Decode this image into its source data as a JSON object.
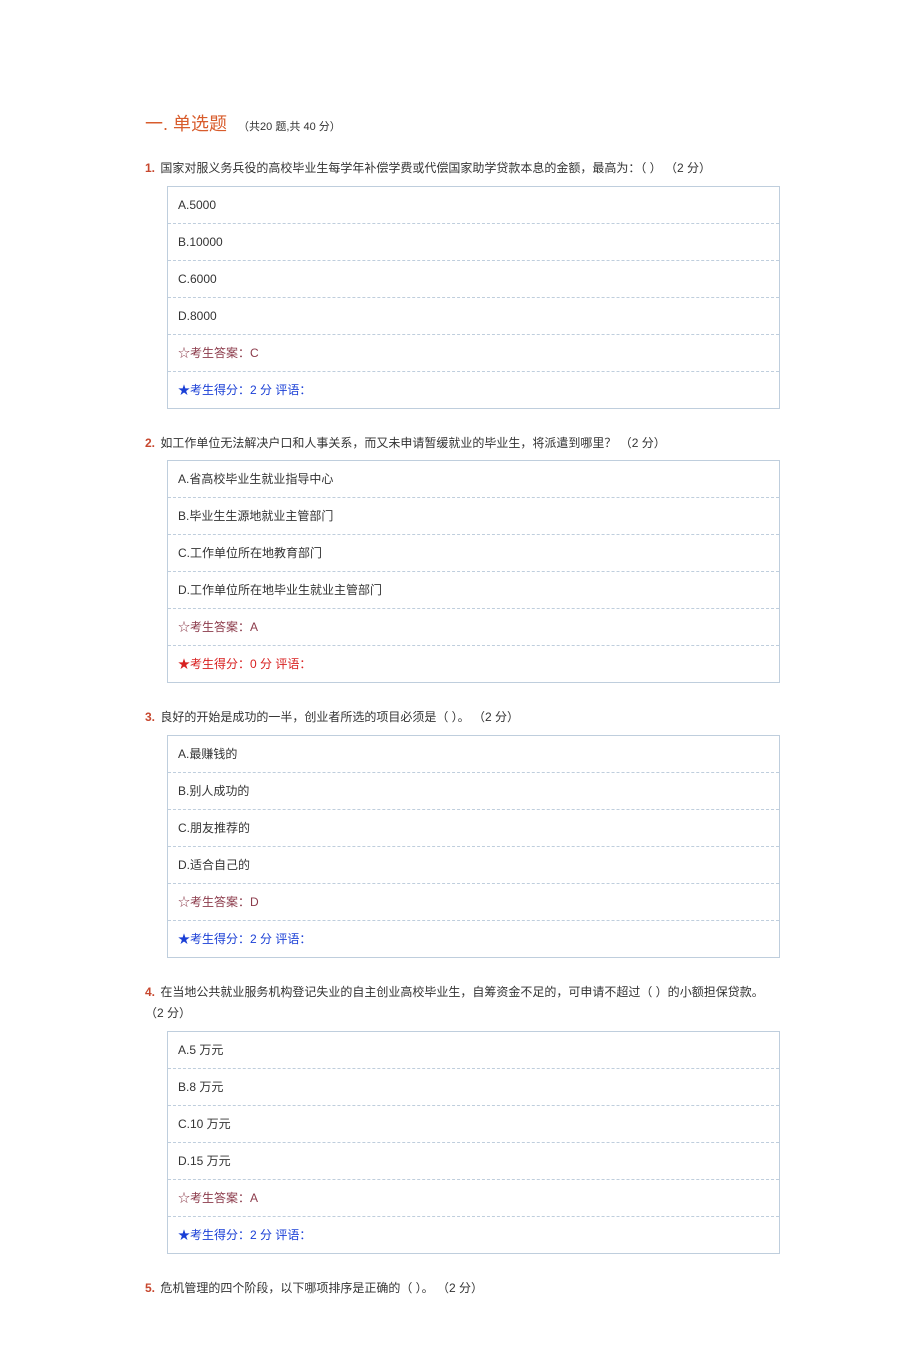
{
  "section": {
    "number": "一",
    "title": "单选题",
    "summary_prefix": "（共",
    "count": "20",
    "count_unit": "题,共",
    "total_points": "40",
    "points_unit": "分）"
  },
  "questions": [
    {
      "num": "1.",
      "stem": "国家对服义务兵役的高校毕业生每学年补偿学费或代偿国家助学贷款本息的金额，最高为：（   ）",
      "points": "（2 分）",
      "options": [
        "A.5000",
        "B.10000",
        "C.6000",
        "D.8000"
      ],
      "answer_label": "☆考生答案：",
      "answer": "C",
      "score_label": "★考生得分：",
      "score": "2 分",
      "comment_label": "评语：",
      "comment": "",
      "score_class": "blue"
    },
    {
      "num": "2.",
      "stem": "如工作单位无法解决户口和人事关系，而又未申请暂缓就业的毕业生，将派遣到哪里？",
      "points": "（2 分）",
      "options": [
        "A.省高校毕业生就业指导中心",
        "B.毕业生生源地就业主管部门",
        "C.工作单位所在地教育部门",
        "D.工作单位所在地毕业生就业主管部门"
      ],
      "answer_label": "☆考生答案：",
      "answer": "A",
      "score_label": "★考生得分：",
      "score": "0 分",
      "comment_label": "评语：",
      "comment": "",
      "score_class": "red"
    },
    {
      "num": "3.",
      "stem": "良好的开始是成功的一半，创业者所选的项目必须是（     ）。",
      "points": "（2 分）",
      "options": [
        "A.最赚钱的",
        "B.别人成功的",
        "C.朋友推荐的",
        "D.适合自己的"
      ],
      "answer_label": "☆考生答案：",
      "answer": "D",
      "score_label": "★考生得分：",
      "score": "2 分",
      "comment_label": "评语：",
      "comment": "",
      "score_class": "blue"
    },
    {
      "num": "4.",
      "stem": "在当地公共就业服务机构登记失业的自主创业高校毕业生，自筹资金不足的，可申请不超过（  ）的小额担保贷款。",
      "points": "（2 分）",
      "options": [
        "A.5 万元",
        "B.8 万元",
        "C.10 万元",
        "D.15 万元"
      ],
      "answer_label": "☆考生答案：",
      "answer": "A",
      "score_label": "★考生得分：",
      "score": "2 分",
      "comment_label": "评语：",
      "comment": "",
      "score_class": "blue"
    },
    {
      "num": "5.",
      "stem": "危机管理的四个阶段，以下哪项排序是正确的（     ）。",
      "points": "（2 分）",
      "options": null
    }
  ]
}
